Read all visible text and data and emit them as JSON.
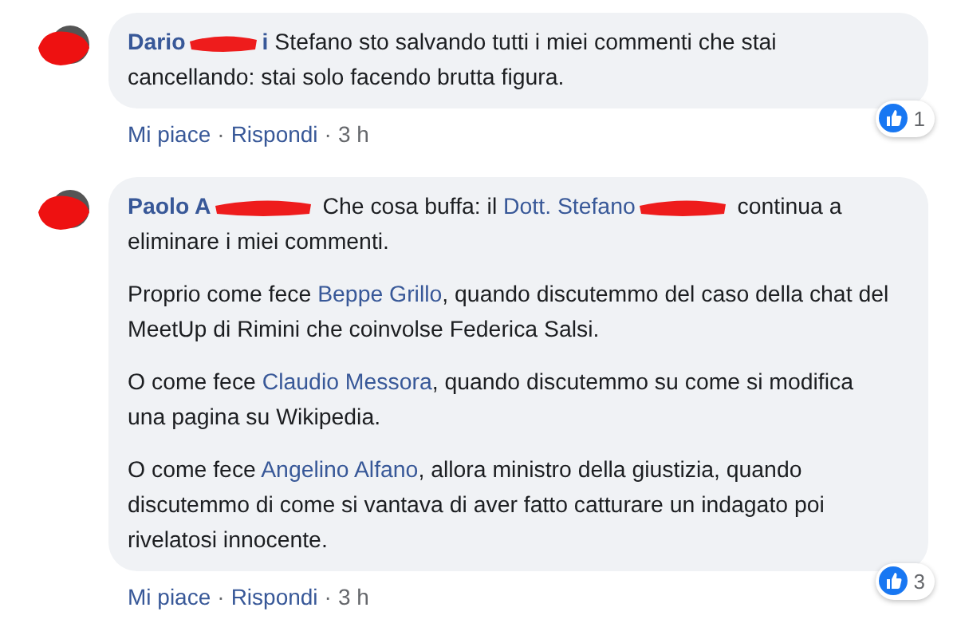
{
  "comments": [
    {
      "author": "Dario",
      "author_tail": "i",
      "paragraphs": [
        [
          {
            "kind": "text",
            "text": " Stefano sto salvando tutti i miei commenti che stai cancellando: stai solo facendo brutta figura."
          }
        ]
      ],
      "reactions": "1",
      "actions": [
        "Mi piace",
        "Rispondi"
      ],
      "separator": "·",
      "time": "3 h"
    },
    {
      "author": "Paolo A",
      "paragraphs": [
        [
          {
            "kind": "text",
            "text": " Che cosa buffa: il "
          },
          {
            "kind": "link",
            "text": "Dott. Stefano"
          },
          {
            "kind": "redaction"
          },
          {
            "kind": "text",
            "text": " continua a eliminare i miei commenti."
          }
        ],
        [
          {
            "kind": "text",
            "text": "Proprio come fece "
          },
          {
            "kind": "link",
            "text": "Beppe Grillo"
          },
          {
            "kind": "text",
            "text": ", quando discutemmo del caso della chat del MeetUp di Rimini che coinvolse Federica Salsi."
          }
        ],
        [
          {
            "kind": "text",
            "text": "O come fece "
          },
          {
            "kind": "link",
            "text": "Claudio Messora"
          },
          {
            "kind": "text",
            "text": ", quando discutemmo su come si modifica una pagina su Wikipedia."
          }
        ],
        [
          {
            "kind": "text",
            "text": "O come fece "
          },
          {
            "kind": "link",
            "text": "Angelino Alfano"
          },
          {
            "kind": "text",
            "text": ", allora ministro della giustizia, quando discutemmo di come si vantava di aver fatto catturare un indagato poi rivelatosi innocente."
          }
        ]
      ],
      "reactions": "3",
      "actions": [
        "Mi piace",
        "Rispondi"
      ],
      "separator": "·",
      "time": "3 h"
    }
  ]
}
